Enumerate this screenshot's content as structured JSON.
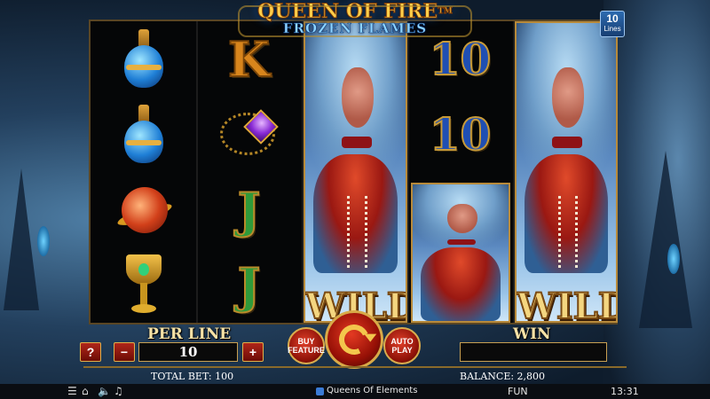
{
  "game": {
    "title": "QUEEN OF FIRE",
    "trademark": "TM",
    "subtitle": "FROZEN FLAMES",
    "lines_count": "10",
    "lines_label": "Lines"
  },
  "reels": {
    "wild_label": "WILD",
    "symbols": {
      "K": "K",
      "J": "J",
      "TEN": "10"
    },
    "reel1": [
      "blue-potion",
      "blue-potion",
      "fire-orb",
      "golden-goblet"
    ],
    "reel2": [
      "K",
      "amulet",
      "J",
      "J"
    ],
    "reel3": [
      "queen-wild-stacked"
    ],
    "reel4": [
      "10",
      "10",
      "queen-wild"
    ],
    "reel5": [
      "queen-wild-stacked"
    ]
  },
  "controls": {
    "per_line_label": "PER LINE",
    "per_line_value": "10",
    "help_label": "?",
    "minus_label": "−",
    "plus_label": "+",
    "buy_feature_label_1": "BUY",
    "buy_feature_label_2": "FEATURE",
    "auto_play_label_1": "AUTO",
    "auto_play_label_2": "PLAY",
    "win_label": "WIN",
    "win_value": ""
  },
  "info": {
    "total_bet": "TOTAL BET: 100",
    "balance": "BALANCE: 2,800"
  },
  "system_bar": {
    "provider": "Queens Of Elements",
    "mode": "FUN",
    "time": "13:31",
    "icons": [
      "menu-icon",
      "home-icon",
      "sound-icon",
      "speed-icon"
    ]
  },
  "colors": {
    "gold": "#d8aa48",
    "red_button": "#961006",
    "reel_bg": "#050607"
  }
}
